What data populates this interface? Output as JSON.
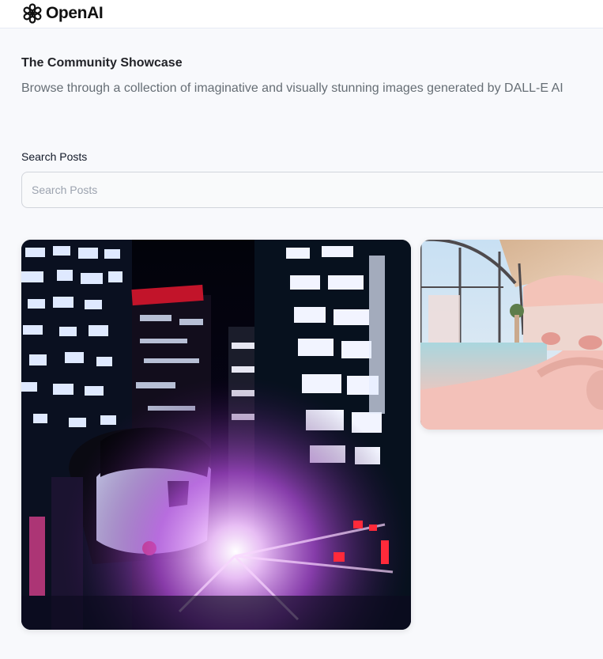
{
  "header": {
    "logo_text": "OpenAI",
    "logo_icon": "openai-logo-icon"
  },
  "main": {
    "title": "The Community Showcase",
    "subtitle": "Browse through a collection of imaginative and visually stunning images generated by DALL-E AI"
  },
  "search": {
    "label": "Search Posts",
    "placeholder": "Search Posts",
    "value": ""
  },
  "cards": [
    {
      "image": "cyberpunk-city-robot-image"
    },
    {
      "image": "pink-interior-pool-image"
    }
  ],
  "colors": {
    "background": "#f8f9fc",
    "title": "#222328",
    "subtitle": "#666e75"
  }
}
